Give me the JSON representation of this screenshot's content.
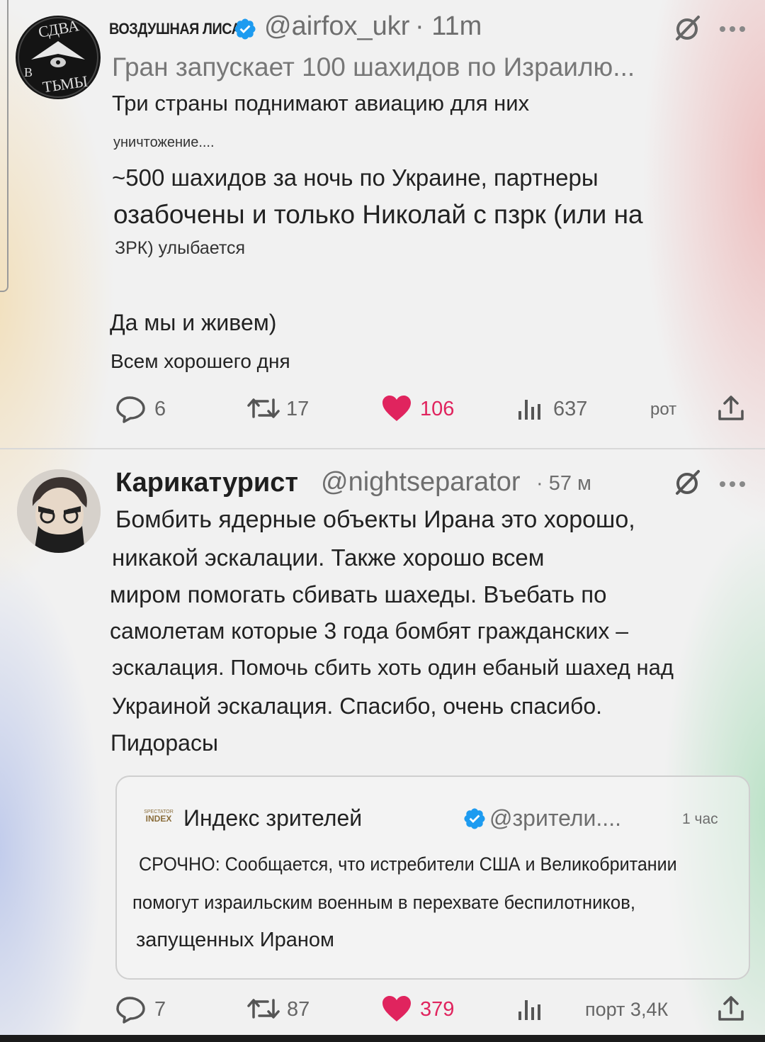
{
  "tweet1": {
    "display_name": "ВОЗДУШНАЯ ЛИСА",
    "handle": "@airfox_ukr",
    "time": "· 11m",
    "line1": "Гран запускает 100 шахидов по Израилю...",
    "line2": "Три страны поднимают авиацию для них",
    "line3": "уничтожение....",
    "line4": "~500 шахидов за ночь по Украине, партнеры",
    "line5": "озабочены и только Николай с пзрк (или на",
    "line6": "ЗРК) улыбается",
    "line7": "Да мы и живем)",
    "line8": "Всем хорошего дня",
    "avatar_text_top": "СДВА",
    "avatar_text_bottom": "ТЬМЫ",
    "avatar_text_left": "В",
    "replies": "6",
    "retweets": "17",
    "likes": "106",
    "views": "637",
    "extra": "рот"
  },
  "tweet2": {
    "display_name": "Карикатурист",
    "handle": "@nightseparator",
    "time": "· 57 м",
    "lines": [
      "Бомбить ядерные объекты Ирана это хорошо,",
      "никакой эскалации. Также хорошо всем",
      "миром помогать сбивать шахеды. Въебать по",
      "самолетам которые 3 года бомбят гражданских –",
      "эскалация. Помочь сбить хоть один ебаный шахед над",
      "Украиной эскалация. Спасибо, очень спасибо.",
      "Пидорасы"
    ],
    "quote": {
      "logo_top": "SPECTATOR",
      "logo_bottom": "INDEX",
      "name": "Индекс зрителей",
      "handle": "@зрители....",
      "time": "1 час",
      "lines": [
        "СРОЧНО: Сообщается, что истребители США и Великобритании",
        "помогут израильским военным в перехвате беспилотников,",
        "запущенных Ираном"
      ]
    },
    "replies": "7",
    "retweets": "87",
    "likes": "379",
    "extra": "порт 3,4К"
  },
  "colors": {
    "like": "#e0245e",
    "verified": "#1d9bf0",
    "grey": "#6e6e6e"
  }
}
